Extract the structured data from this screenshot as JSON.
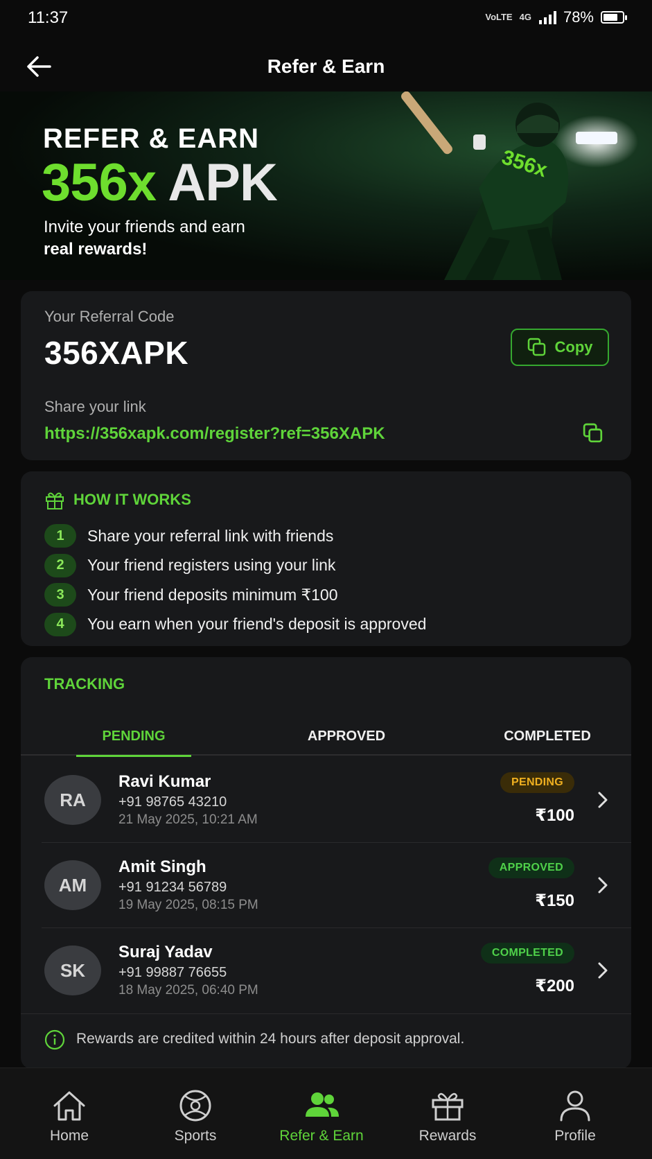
{
  "status_bar": {
    "time": "11:37",
    "battery": "78%",
    "battery_level": 0.78,
    "net_top": "VoLTE",
    "net_sub": "4G"
  },
  "header": {
    "title": "Refer & Earn"
  },
  "hero": {
    "kicker": "REFER & EARN",
    "brand_accent": "356x",
    "brand_rest": "APK",
    "subtitle_line1": "Invite your friends and earn",
    "subtitle_line2": "real rewards!",
    "jersey_text": "356x"
  },
  "referral": {
    "code_label": "Your Referral Code",
    "code": "356XAPK",
    "copy_label": "Copy",
    "share_label": "Share your link",
    "share_link": "https://356xapk.com/register?ref=356XAPK"
  },
  "how_it_works": {
    "title": "HOW IT WORKS",
    "steps": [
      {
        "num": "1",
        "text": "Share your referral link with friends"
      },
      {
        "num": "2",
        "text": "Your friend registers using your link"
      },
      {
        "num": "3",
        "text": "Your friend deposits minimum ₹100"
      },
      {
        "num": "4",
        "text": "You earn when your friend's deposit is approved"
      }
    ]
  },
  "tracking": {
    "title": "TRACKING",
    "tabs": [
      {
        "label": "PENDING",
        "active": true
      },
      {
        "label": "APPROVED",
        "active": false
      },
      {
        "label": "COMPLETED",
        "active": false
      }
    ],
    "rows": [
      {
        "initials": "RA",
        "name": "Ravi Kumar",
        "phone": "+91 98765 43210",
        "date": "21 May 2025, 10:21 AM",
        "status": "PENDING",
        "amount": "₹100"
      },
      {
        "initials": "AM",
        "name": "Amit Singh",
        "phone": "+91 91234 56789",
        "date": "19 May 2025, 08:15 PM",
        "status": "APPROVED",
        "amount": "₹150"
      },
      {
        "initials": "SK",
        "name": "Suraj Yadav",
        "phone": "+91 99887 76655",
        "date": "18 May 2025, 06:40 PM",
        "status": "COMPLETED",
        "amount": "₹200"
      }
    ],
    "note": "Rewards are credited within 24 hours after deposit approval."
  },
  "bottom_nav": {
    "items": [
      {
        "label": "Home",
        "icon": "home-icon"
      },
      {
        "label": "Sports",
        "icon": "ball-icon"
      },
      {
        "label": "Refer & Earn",
        "icon": "users-icon",
        "active": true
      },
      {
        "label": "Rewards",
        "icon": "gift-icon"
      },
      {
        "label": "Profile",
        "icon": "user-icon"
      }
    ]
  },
  "colors": {
    "accent": "#5fd43a",
    "background": "#0b0b0b",
    "card": "#18191b",
    "pending": "#f0b020"
  }
}
